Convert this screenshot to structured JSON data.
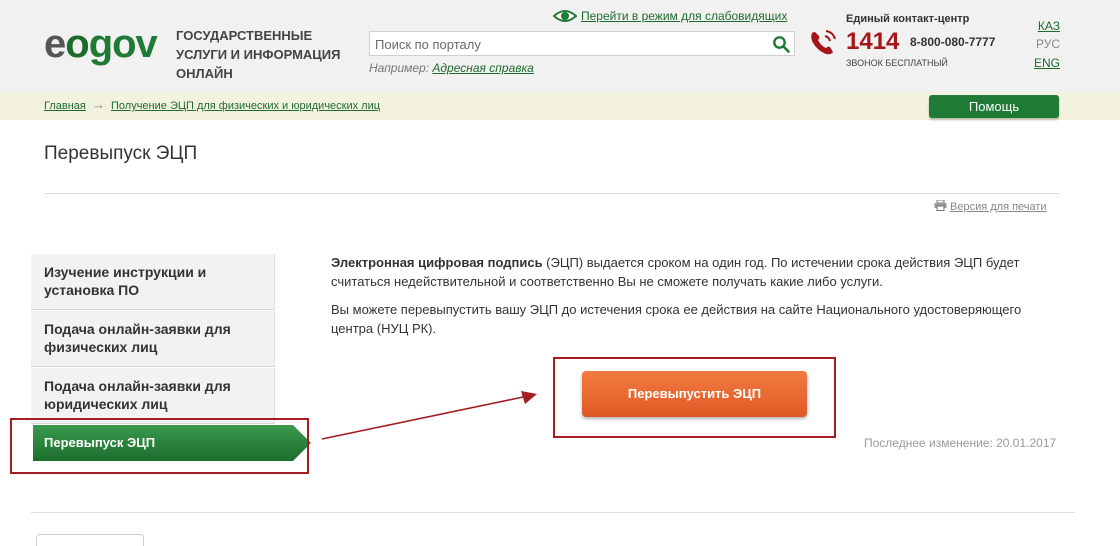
{
  "header": {
    "logo": {
      "e": "e",
      "o": "o",
      "gov": "gov"
    },
    "tagline": "ГОСУДАРСТВЕННЫЕ УСЛУГИ И ИНФОРМАЦИЯ ОНЛАЙН",
    "low_vision_link": "Перейти в режим для слабовидящих",
    "search": {
      "placeholder": "Поиск по порталу",
      "value": ""
    },
    "example_label": "Например:",
    "example_link": "Адресная справка",
    "contact": {
      "title": "Единый контакт-центр",
      "short": "1414",
      "long": "8-800-080-7777",
      "free": "ЗВОНОК БЕСПЛАТНЫЙ"
    },
    "languages": [
      "КАЗ",
      "РУС",
      "ENG"
    ]
  },
  "breadcrumb": {
    "home": "Главная",
    "separator": "→",
    "current": "Получение ЭЦП для физических и юридических лиц"
  },
  "help_button": "Помощь",
  "page_title": "Перевыпуск ЭЦП",
  "print_link": "Версия для печати",
  "sidebar": {
    "items": [
      {
        "label": "Изучение инструкции и установка ПО"
      },
      {
        "label": "Подача онлайн-заявки для физических лиц"
      },
      {
        "label": "Подача онлайн-заявки для юридических лиц"
      }
    ],
    "active": "Перевыпуск ЭЦП"
  },
  "content": {
    "p1_bold": "Электронная цифровая подпись",
    "p1_rest": " (ЭЦП) выдается сроком на один год. По истечении срока действия ЭЦП будет считаться недействительной и соответственно Вы не сможете получать какие либо услуги.",
    "p2": "Вы можете перевыпустить вашу ЭЦП до истечения срока ее действия на сайте Национального удостоверяющего центра (НУЦ РК).",
    "reissue_button": "Перевыпустить ЭЦП",
    "last_modified": "Последнее изменение: 20.01.2017"
  },
  "colors": {
    "brand_green": "#1e7a34",
    "accent_orange": "#e8662f",
    "highlight_red": "#a31d22"
  },
  "icons": {
    "eye": "eye-icon",
    "search": "search-icon",
    "phone": "phone-icon",
    "print": "printer-icon"
  }
}
